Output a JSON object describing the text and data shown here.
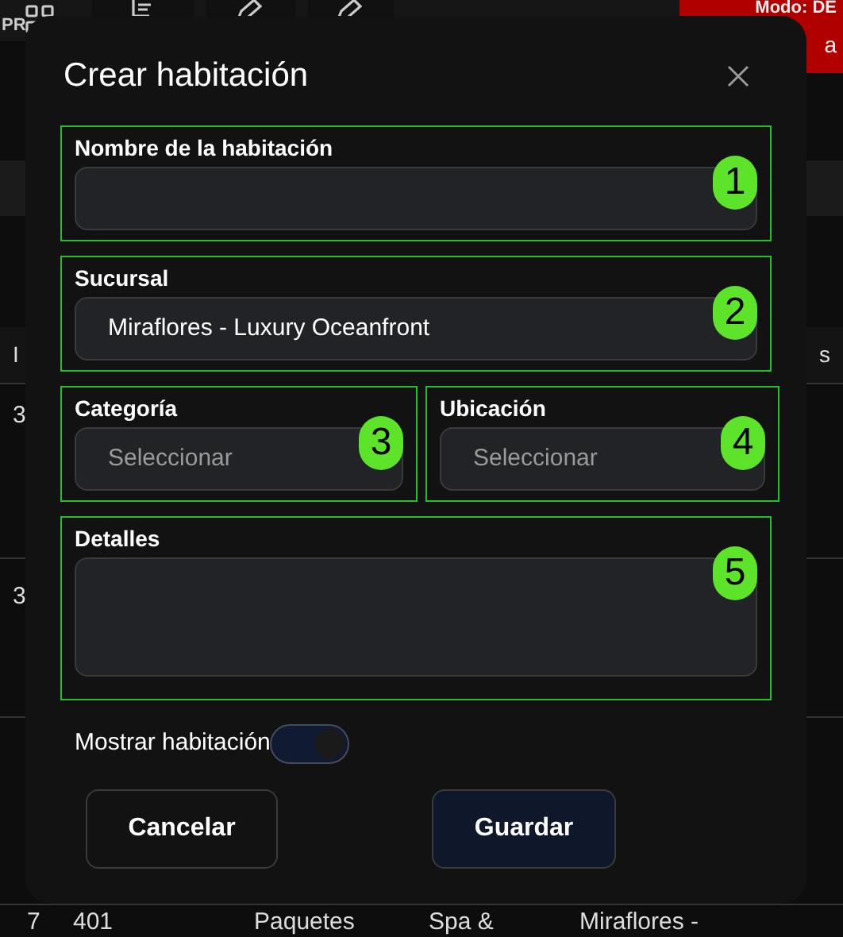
{
  "background": {
    "top_label": "PR",
    "mode_banner": {
      "title": "Modo: DE",
      "subtitle": "a"
    },
    "table": {
      "header_left": "I",
      "header_right": "s",
      "rows": [
        {
          "column_1": "3"
        },
        {
          "column_1": "3"
        },
        {
          "column_1": "7",
          "column_2": "401",
          "column_3": "Paquetes",
          "column_4": "Spa &",
          "column_5": "Miraflores -"
        }
      ]
    }
  },
  "dialog": {
    "title": "Crear habitación",
    "fields": [
      {
        "kind": "text",
        "label": "Nombre de la habitación",
        "annotation": "1"
      },
      {
        "kind": "select",
        "label": "Sucursal",
        "value": "Miraflores - Luxury Oceanfront",
        "annotation": "2"
      },
      {
        "kind": "select",
        "label": "Categoría",
        "placeholder": "Seleccionar",
        "annotation": "3"
      },
      {
        "kind": "select",
        "label": "Ubicación",
        "placeholder": "Seleccionar",
        "annotation": "4"
      },
      {
        "kind": "textarea",
        "label": "Detalles",
        "annotation": "5"
      }
    ],
    "toggle": {
      "label": "Mostrar habitación",
      "on": true
    },
    "buttons": [
      {
        "label": "Cancelar",
        "kind": "secondary"
      },
      {
        "label": "Guardar",
        "kind": "primary"
      }
    ]
  }
}
